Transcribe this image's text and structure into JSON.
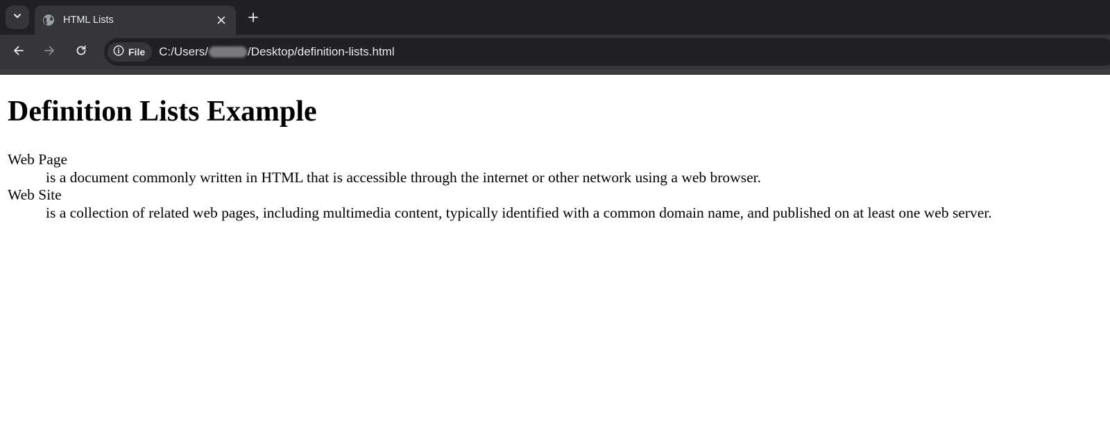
{
  "browser": {
    "tab": {
      "title": "HTML Lists",
      "favicon": "globe-icon"
    },
    "new_tab_icon": "plus-icon",
    "tab_search_icon": "chevron-down-icon",
    "toolbar": {
      "back_icon": "back-arrow-icon",
      "forward_icon": "forward-arrow-icon",
      "reload_icon": "reload-icon",
      "site_info_label": "File",
      "site_info_icon": "info-icon",
      "url_prefix": "C:/Users/",
      "url_suffix": "/Desktop/definition-lists.html"
    },
    "colors": {
      "tabstrip": "#202124",
      "toolbar": "#35363a",
      "omnibox": "#202124",
      "text": "#e8eaed"
    }
  },
  "page": {
    "heading": "Definition Lists Example",
    "definitions": [
      {
        "term": "Web Page",
        "description": "is a document commonly written in HTML that is accessible through the internet or other network using a web browser."
      },
      {
        "term": "Web Site",
        "description": "is a collection of related web pages, including multimedia content, typically identified with a common domain name, and published on at least one web server."
      }
    ]
  }
}
